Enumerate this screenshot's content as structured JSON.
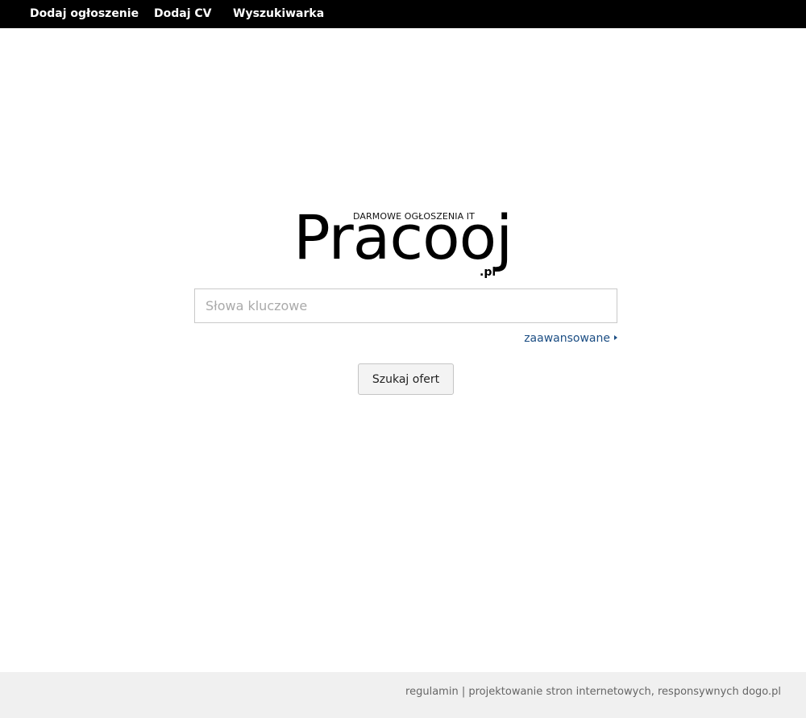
{
  "nav": {
    "items": [
      {
        "label": "Dodaj ogłoszenie"
      },
      {
        "label": "Dodaj CV"
      },
      {
        "label": "Wyszukiwarka"
      }
    ]
  },
  "logo": {
    "tagline": "DARMOWE OGŁOSZENIA IT",
    "name": "Pracooj",
    "suffix": ".pl"
  },
  "search": {
    "value": "",
    "placeholder": "Słowa kluczowe",
    "advanced_label": "zaawansowane",
    "button_label": "Szukaj ofert"
  },
  "footer": {
    "terms_label": "regulamin",
    "separator": "|",
    "credit_label": "projektowanie stron internetowych, responsywnych dogo.pl"
  },
  "colors": {
    "nav_background": "#000000",
    "link": "#1c4e84",
    "footer_background": "#f0f0f0"
  }
}
